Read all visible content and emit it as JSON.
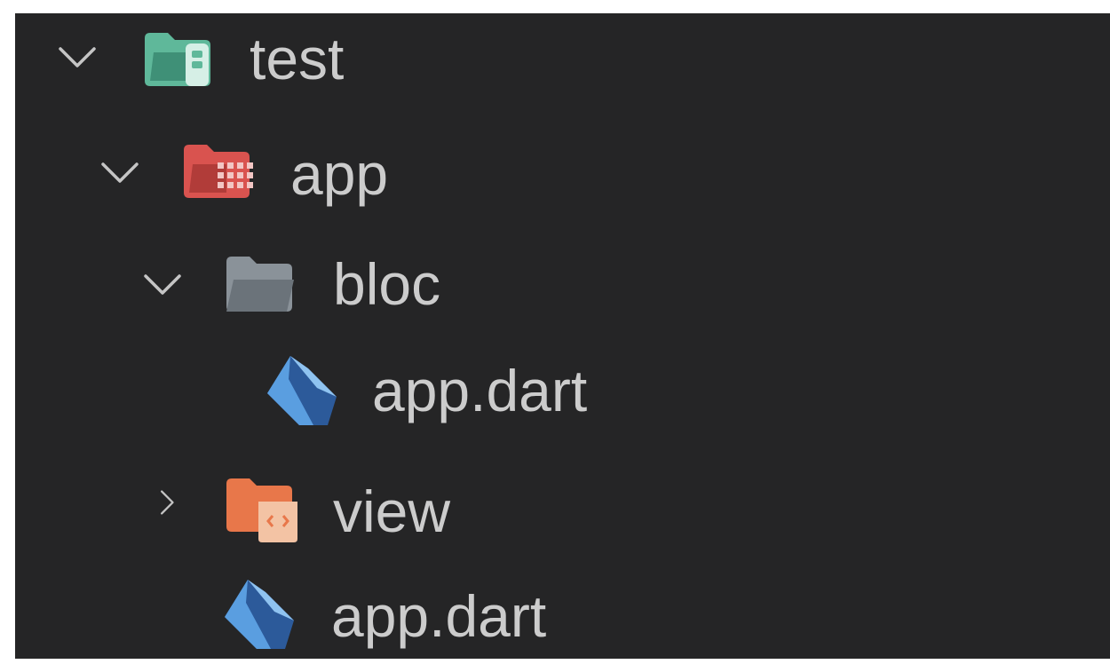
{
  "explorer": {
    "tree": [
      {
        "name": "test",
        "state": "expanded",
        "icon": "folder-test-icon",
        "color": "#5fb89a"
      },
      {
        "name": "app",
        "state": "expanded",
        "icon": "folder-app-icon",
        "color": "#d9534f"
      },
      {
        "name": "bloc",
        "state": "expanded",
        "icon": "folder-icon",
        "color": "#8a9299"
      },
      {
        "name": "app.dart",
        "state": "file",
        "icon": "dart-icon",
        "color": "#4a8fd8"
      },
      {
        "name": "view",
        "state": "collapsed",
        "icon": "folder-view-icon",
        "color": "#e8774a"
      },
      {
        "name": "app.dart",
        "state": "file",
        "icon": "dart-icon",
        "color": "#4a8fd8"
      }
    ]
  },
  "colors": {
    "background": "#252526",
    "text": "#cccccc",
    "chevron": "#c5c5c5"
  }
}
